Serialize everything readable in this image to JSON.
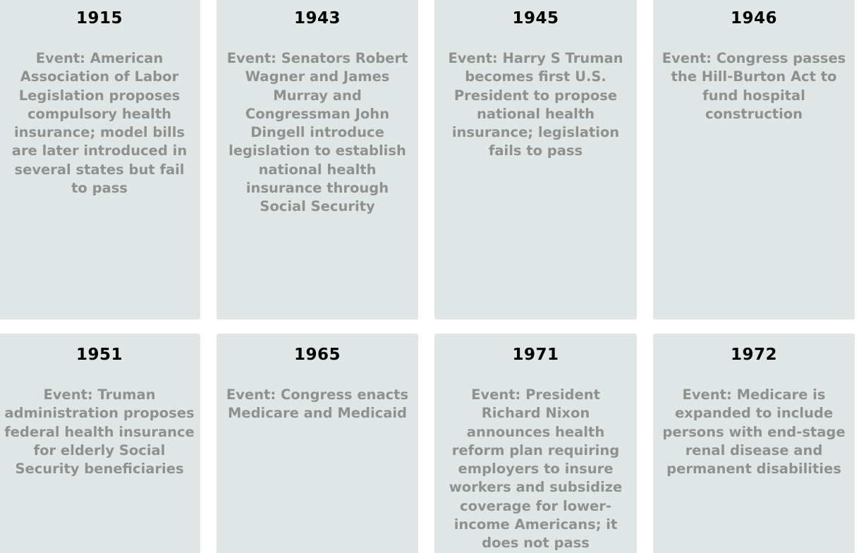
{
  "timeline": [
    {
      "year": "1915",
      "event": "Event: American Association of Labor Legislation proposes compulsory health insurance; model bills are later introduced in several states but fail to pass"
    },
    {
      "year": "1943",
      "event": "Event: Senators Robert Wagner and James Murray and Congressman John Dingell introduce legislation to establish national health insurance through Social Security"
    },
    {
      "year": "1945",
      "event": "Event: Harry S Truman becomes first U.S. President to propose national health insurance; legislation fails to pass"
    },
    {
      "year": "1946",
      "event": "Event: Congress passes the Hill-Burton Act to fund hospital construction"
    },
    {
      "year": "1951",
      "event": "Event: Truman administration proposes federal health insurance for elderly Social Security beneficiaries"
    },
    {
      "year": "1965",
      "event": "Event: Congress enacts Medicare and Medicaid"
    },
    {
      "year": "1971",
      "event": "Event: President Richard Nixon announces health reform plan requiring employers to insure workers and subsidize coverage for lower-income Americans; it does not pass"
    },
    {
      "year": "1972",
      "event": "Event: Medicare is expanded to include persons with end-stage renal disease and permanent disabilities"
    }
  ],
  "colors": {
    "card_background": "#dfe6e5",
    "year_text": "#000000",
    "event_text": "#8f9190"
  }
}
